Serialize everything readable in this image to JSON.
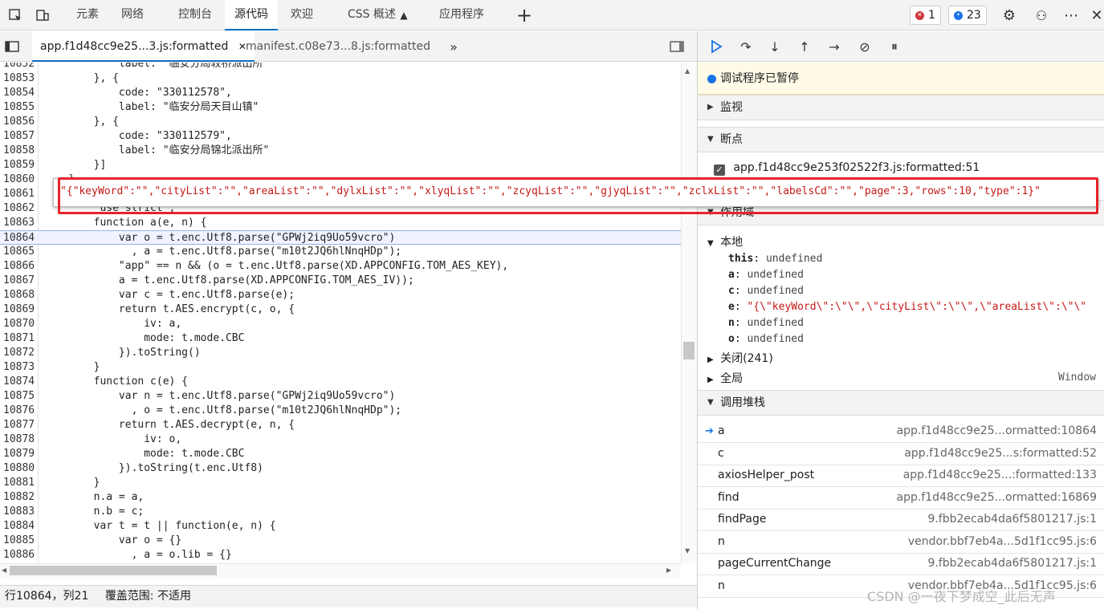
{
  "top_tabs": [
    "元素",
    "网络",
    "控制台",
    "源代码",
    "欢迎",
    "CSS 概述",
    "应用程序"
  ],
  "active_top_tab": "源代码",
  "badges": {
    "errors": "1",
    "messages": "23"
  },
  "colors": {
    "accent": "#0f6cbd",
    "error": "#d13438",
    "info": "#1a73e8",
    "highlight_box": "#e8232a"
  },
  "editor_tabs": {
    "active": "app.f1d48cc9e25...3.js:formatted",
    "second": "manifest.c08e73...8.js:formatted"
  },
  "code_lines": [
    {
      "n": "10852",
      "t": "            label: \"临安分局较桥派出所\""
    },
    {
      "n": "10853",
      "t": "        }, {"
    },
    {
      "n": "10854",
      "t": "            code: \"330112578\","
    },
    {
      "n": "10855",
      "t": "            label: \"临安分局天目山镇\""
    },
    {
      "n": "10856",
      "t": "        }, {"
    },
    {
      "n": "10857",
      "t": "            code: \"330112579\","
    },
    {
      "n": "10858",
      "t": "            label: \"临安分局锦北派出所\""
    },
    {
      "n": "10859",
      "t": "        }]"
    },
    {
      "n": "10860",
      "t": "    },"
    },
    {
      "n": "10861",
      "t": ""
    },
    {
      "n": "10862",
      "t": "        \"use strict\";"
    },
    {
      "n": "10863",
      "t": "        function a(e, n) {"
    },
    {
      "n": "10864",
      "t": "            var o = t.enc.Utf8.parse(\"GPWj2iq9Uo59vcro\")"
    },
    {
      "n": "10865",
      "t": "              , a = t.enc.Utf8.parse(\"m10t2JQ6hlNnqHDp\");"
    },
    {
      "n": "10866",
      "t": "            \"app\" == n && (o = t.enc.Utf8.parse(XD.APPCONFIG.TOM_AES_KEY),"
    },
    {
      "n": "10867",
      "t": "            a = t.enc.Utf8.parse(XD.APPCONFIG.TOM_AES_IV));"
    },
    {
      "n": "10868",
      "t": "            var c = t.enc.Utf8.parse(e);"
    },
    {
      "n": "10869",
      "t": "            return t.AES.encrypt(c, o, {"
    },
    {
      "n": "10870",
      "t": "                iv: a,"
    },
    {
      "n": "10871",
      "t": "                mode: t.mode.CBC"
    },
    {
      "n": "10872",
      "t": "            }).toString()"
    },
    {
      "n": "10873",
      "t": "        }"
    },
    {
      "n": "10874",
      "t": "        function c(e) {"
    },
    {
      "n": "10875",
      "t": "            var n = t.enc.Utf8.parse(\"GPWj2iq9Uo59vcro\")"
    },
    {
      "n": "10876",
      "t": "              , o = t.enc.Utf8.parse(\"m10t2JQ6hlNnqHDp\");"
    },
    {
      "n": "10877",
      "t": "            return t.AES.decrypt(e, n, {"
    },
    {
      "n": "10878",
      "t": "                iv: o,"
    },
    {
      "n": "10879",
      "t": "                mode: t.mode.CBC"
    },
    {
      "n": "10880",
      "t": "            }).toString(t.enc.Utf8)"
    },
    {
      "n": "10881",
      "t": "        }"
    },
    {
      "n": "10882",
      "t": "        n.a = a,"
    },
    {
      "n": "10883",
      "t": "        n.b = c;"
    },
    {
      "n": "10884",
      "t": "        var t = t || function(e, n) {"
    },
    {
      "n": "10885",
      "t": "            var o = {}"
    },
    {
      "n": "10886",
      "t": "              , a = o.lib = {}"
    }
  ],
  "tooltip_value": "\"{\"keyWord\":\"\",\"cityList\":\"\",\"areaList\":\"\",\"dylxList\":\"\",\"xlyqList\":\"\",\"zcyqList\":\"\",\"gjyqList\":\"\",\"zclxList\":\"\",\"labelsCd\":\"\",\"page\":3,\"rows\":10,\"type\":1}\"",
  "status": {
    "position": "行10864，列21",
    "coverage": "覆盖范围: 不适用"
  },
  "right": {
    "paused": "调试程序已暂停",
    "watch": "监视",
    "breakpoints": "断点",
    "breakpoint_item": "app.f1d48cc9e253f02522f3.js:formatted:51",
    "scope": "作用域",
    "local": "本地",
    "scope_vars": [
      {
        "k": "this",
        "v": "undefined"
      },
      {
        "k": "a",
        "v": "undefined"
      },
      {
        "k": "c",
        "v": "undefined"
      },
      {
        "k": "e",
        "v": "\"{\\\"keyWord\\\":\\\"\\\",\\\"cityList\\\":\\\"\\\",\\\"areaList\\\":\\\"\\\""
      },
      {
        "k": "n",
        "v": "undefined"
      },
      {
        "k": "o",
        "v": "undefined"
      }
    ],
    "closure": "关闭(241)",
    "global": "全局",
    "global_value": "Window",
    "callstack": "调用堆栈",
    "stack": [
      {
        "fn": "a",
        "loc": "app.f1d48cc9e25...ormatted:10864"
      },
      {
        "fn": "c",
        "loc": "app.f1d48cc9e25...s:formatted:52"
      },
      {
        "fn": "axiosHelper_post",
        "loc": "app.f1d48cc9e25...:formatted:133"
      },
      {
        "fn": "find",
        "loc": "app.f1d48cc9e25...ormatted:16869"
      },
      {
        "fn": "findPage",
        "loc": "9.fbb2ecab4da6f5801217.js:1"
      },
      {
        "fn": "n",
        "loc": "vendor.bbf7eb4a...5d1f1cc95.js:6"
      },
      {
        "fn": "pageCurrentChange",
        "loc": "9.fbb2ecab4da6f5801217.js:1"
      },
      {
        "fn": "n",
        "loc": "vendor.bbf7eb4a...5d1f1cc95.js:6"
      }
    ]
  },
  "watermark": "CSDN @一夜下梦成空_此后无声"
}
